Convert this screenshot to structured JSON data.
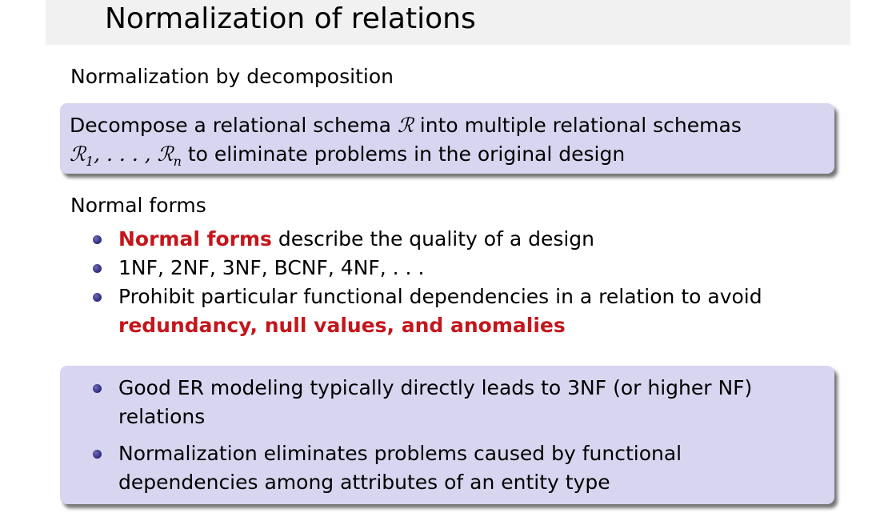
{
  "title": "Normalization of relations",
  "section1": {
    "heading": "Normalization by decomposition"
  },
  "block1": {
    "line1_a": "Decompose a relational schema ",
    "line1_math": "ℛ",
    "line1_b": " into multiple relational schemas",
    "line2_math_r1": "ℛ",
    "line2_math_sub1": "1",
    "line2_math_mid": ", . . . , ",
    "line2_math_rn": "ℛ",
    "line2_math_subn": "n",
    "line2_b": " to eliminate problems in the original design"
  },
  "section2": {
    "heading": "Normal forms",
    "items": [
      {
        "red": "Normal forms",
        "text": " describe the quality of a design"
      },
      {
        "text": "1NF, 2NF, 3NF, BCNF, 4NF, . . ."
      },
      {
        "text": "Prohibit particular functional dependencies in a relation to avoid",
        "red2": "redundancy, null values, and anomalies"
      }
    ]
  },
  "block2": {
    "items": [
      "Good ER modeling typically directly leads to 3NF (or higher NF) relations",
      "Normalization eliminates problems caused by functional dependencies among attributes of an entity type"
    ]
  },
  "colors": {
    "accent_red": "#c4161c",
    "block_bg": "#d7d5ef",
    "title_bg": "#f1f1f1"
  }
}
